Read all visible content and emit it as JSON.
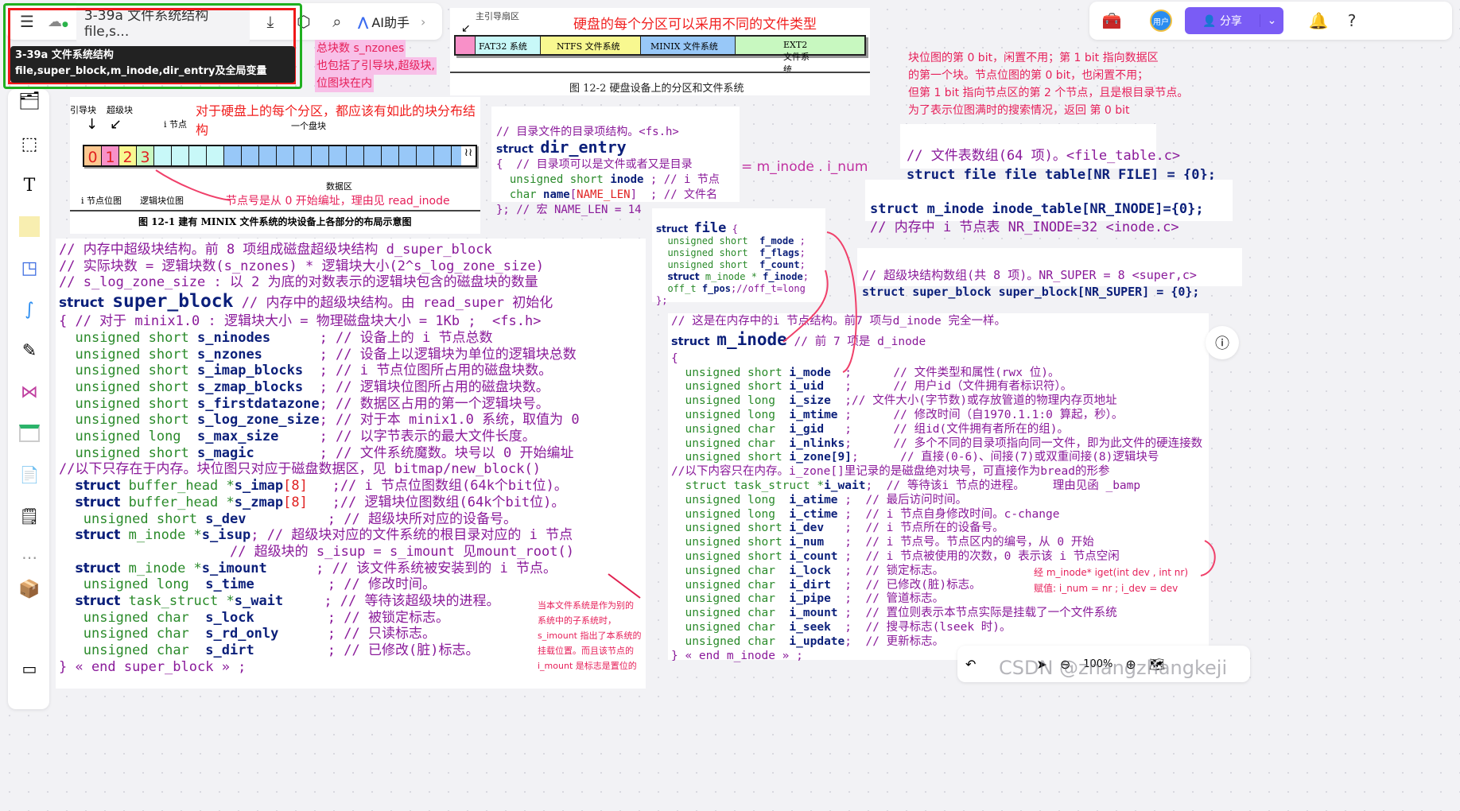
{
  "toolbar": {
    "menu_icon": "hamburger-icon",
    "cloud_icon": "cloud-synced-icon",
    "doc_title": "3-39a 文件系统结构file,s...",
    "tooltip": "3-39a  文件系统结构file,super_block,m_inode,dir_entry及全局变量",
    "ai_label": "AI助手",
    "share_label": "分享",
    "avatar_label": "用户"
  },
  "bottom_bar": {
    "zoom": "100%",
    "watermark": "CSDN @zhangzhangkeji"
  },
  "pink_note": [
    "总块数 s_nzones",
    "也包括了引导块,超级块,",
    "位图块在内"
  ],
  "fig122": {
    "label_mbr": "主引导扇区",
    "red_title": "硬盘的每个分区可以采用不同的文件类型",
    "partitions": [
      "FAT32 系统",
      "NTFS 文件系统",
      "MINIX 文件系统",
      "EXT2 文件系统"
    ],
    "caption": "图 12-2  硬盘设备上的分区和文件系统"
  },
  "fig121": {
    "label_boot": "引导块",
    "label_super": "超级块",
    "label_inode": "i 节点",
    "label_block": "一个盘块",
    "label_imap": "i 节点位图",
    "label_zmap": "逻辑块位图",
    "label_data": "数据区",
    "red_title": "对于硬盘上的每个分区，都应该有如此的块分布结构",
    "red_note": "节点号是从 0 开始编址，理由见 read_inode",
    "cells": [
      "0",
      "1",
      "2",
      "3"
    ],
    "caption": "图 12-1  建有 MINIX 文件系统的块设备上各部分的布局示意图"
  },
  "right_note": [
    "块位图的第 0  bit，闲置不用；第 1 bit 指向数据区",
    "的第一个块。节点位图的第 0 bit，也闲置不用；",
    "但第 1 bit 指向节点区的第 2 个节点，且是根目录节点。",
    "为了表示位图满时的搜索情况，返回 第 0 bit"
  ],
  "dir_entry": {
    "l1": "// 目录文件的目录项结构。<fs.h>",
    "struct": "struct",
    "name": "dir_entry",
    "l3": "{  // 目录项可以是文件或者又是目录",
    "l4a": "unsigned short",
    "l4b": "inode",
    "l4c": " ; // i 节点",
    "l5a": "char",
    "l5b": "name",
    "l5c": "NAME_LEN",
    "l5d": "  ; // 文件名",
    "l6": "}; // 宏 NAME_LEN = 14",
    "annot": "= m_inode . i_num"
  },
  "file_table": {
    "c": "// 文件表数组(64 项)。<file_table.c>",
    "code": "struct file file_table[NR_FILE] = {0};"
  },
  "inode_table": {
    "code": "struct m_inode inode_table[NR_INODE]={0};",
    "c": "// 内存中 i 节点表 NR_INODE=32 <inode.c>"
  },
  "super_array": {
    "c": "// 超级块结构数组(共 8 项)。NR_SUPER = 8 <super,c>",
    "code": "struct super_block super_block[NR_SUPER] = {0};"
  },
  "file_struct": {
    "head": "file",
    "fields": [
      {
        "t": "unsigned short",
        "n": "f_mode",
        "e": " ;"
      },
      {
        "t": "unsigned short",
        "n": "f_flags",
        "e": ";"
      },
      {
        "t": "unsigned short",
        "n": "f_count",
        "e": ";"
      },
      {
        "t": "m_inode *",
        "n": "f_inode",
        "e": ";"
      },
      {
        "t": "off_t",
        "n": "f_pos",
        "e": ";//off_t=long"
      }
    ],
    "end": "};"
  },
  "super_block": {
    "c1": "// 内存中超级块结构。前 8 项组成磁盘超级块结构 d_super_block",
    "c2": "// 实际块数 = 逻辑块数(s_nzones) * 逻辑块大小(2^s_log_zone_size)",
    "c3": "// s_log_zone_size : 以 2 为底的对数表示的逻辑块包含的磁盘块的数量",
    "name": "super_block",
    "c4": " // 内存中的超级块结构。由 read_super 初始化",
    "c5": "{ // 对于 minix1.0 : 逻辑块大小 = 物理磁盘块大小 = 1Kb ;  <fs.h>",
    "fields": [
      [
        "unsigned short",
        "s_ninodes",
        "      ; // 设备上的 i 节点总数"
      ],
      [
        "unsigned short",
        "s_nzones",
        "       ; // 设备上以逻辑块为单位的逻辑块总数"
      ],
      [
        "unsigned short",
        "s_imap_blocks",
        "  ; // i 节点位图所占用的磁盘块数。"
      ],
      [
        "unsigned short",
        "s_zmap_blocks",
        "  ; // 逻辑块位图所占用的磁盘块数。"
      ],
      [
        "unsigned short",
        "s_firstdatazone",
        "; // 数据区占用的第一个逻辑块号。"
      ],
      [
        "unsigned short",
        "s_log_zone_size",
        "; // 对于本 minix1.0 系统，取值为 0"
      ],
      [
        "unsigned long ",
        "s_max_size",
        "     ; // 以字节表示的最大文件长度。"
      ],
      [
        "unsigned short",
        "s_magic",
        "        ; // 文件系统魔数。块号以 0 开始编址"
      ]
    ],
    "mem_note": "//以下只存在于内存。块位图只对应于磁盘数据区，见 bitmap/new_block()",
    "fields2": [
      [
        "struct",
        "buffer_head *",
        "s_imap",
        "[8]",
        "   ;// i 节点位图数组(64k个bit位)。"
      ],
      [
        "struct",
        "buffer_head *",
        "s_zmap",
        "[8]",
        "   ;// 逻辑块位图数组(64k个bit位)。"
      ],
      [
        "",
        "unsigned short ",
        "s_dev",
        "",
        "          ; // 超级块所对应的设备号。"
      ],
      [
        "struct",
        "m_inode *",
        "s_isup",
        "",
        "; // 超级块对应的文件系统的根目录对应的 i 节点"
      ],
      [
        "",
        "",
        "",
        "",
        "                  // 超级块的 s_isup = s_imount 见mount_root()"
      ],
      [
        "struct",
        "m_inode *",
        "s_imount",
        "",
        "      ; // 该文件系统被安装到的 i 节点。"
      ],
      [
        "",
        "unsigned long  ",
        "s_time",
        "",
        "         ; // 修改时间。"
      ],
      [
        "struct",
        "task_struct *",
        "s_wait",
        "",
        "     ; // 等待该超级块的进程。"
      ],
      [
        "",
        "unsigned char  ",
        "s_lock",
        "",
        "         ; // 被锁定标志。"
      ],
      [
        "",
        "unsigned char  ",
        "s_rd_only",
        "",
        "      ; // 只读标志。"
      ],
      [
        "",
        "unsigned char  ",
        "s_dirt",
        "",
        "         ; // 已修改(脏)标志。"
      ]
    ],
    "end": "} « end super_block » ;",
    "note": [
      "当本文件系统是作为别的",
      "系统中的子系统时，",
      "s_imount 指出了本系统的",
      "挂载位置。而且该节点的",
      "i_mount 是标志是置位的"
    ]
  },
  "m_inode": {
    "c1": "// 这是在内存中的i 节点结构。前7 项与d_inode 完全一样。",
    "name": "m_inode",
    "c2": " // 前 7 项是 d_inode",
    "fields": [
      [
        "unsigned short ",
        "i_mode",
        "  ;",
        "      // 文件类型和属性(rwx 位)。"
      ],
      [
        "unsigned short ",
        "i_uid",
        "   ;",
        "      // 用户id（文件拥有者标识符）。"
      ],
      [
        "unsigned long  ",
        "i_size",
        "  ;",
        "// 文件大小(字节数)或存放管道的物理内存页地址"
      ],
      [
        "unsigned long  ",
        "i_mtime",
        " ;",
        "      // 修改时间（自1970.1.1:0 算起，秒）。"
      ],
      [
        "unsigned char  ",
        "i_gid",
        "   ;",
        "      // 组id(文件拥有者所在的组)。"
      ],
      [
        "unsigned char  ",
        "i_nlinks",
        ";",
        "      // 多个不同的目录项指向同一文件，即为此文件的硬连接数"
      ],
      [
        "unsigned short ",
        "i_zone[9]",
        ";",
        "      // 直接(0-6)、间接(7)或双重间接(8)逻辑块号"
      ]
    ],
    "mem_note": "//以下内容只在内存。i_zone[]里记录的是磁盘绝对块号，可直接作为bread的形参",
    "fields2": [
      [
        "struct task_struct *",
        "i_wait",
        ";",
        "  // 等待该i 节点的进程。    理由见函 _bamp"
      ],
      [
        "unsigned long  ",
        "i_atime",
        " ;",
        "  // 最后访问时间。"
      ],
      [
        "unsigned long  ",
        "i_ctime",
        " ;",
        "  // i 节点自身修改时间。c-change"
      ],
      [
        "unsigned short ",
        "i_dev",
        "   ;",
        "  // i 节点所在的设备号。"
      ],
      [
        "unsigned short ",
        "i_num",
        "   ;",
        "  // i 节点号。节点区内的编号，从 0 开始"
      ],
      [
        "unsigned short ",
        "i_count",
        " ;",
        "  // i 节点被使用的次数，0 表示该 i 节点空闲"
      ],
      [
        "unsigned char  ",
        "i_lock",
        "  ;",
        "  // 锁定标志。"
      ],
      [
        "unsigned char  ",
        "i_dirt",
        "  ;",
        "  // 已修改(脏)标志。"
      ],
      [
        "unsigned char  ",
        "i_pipe",
        "  ;",
        "  // 管道标志。"
      ],
      [
        "unsigned char  ",
        "i_mount",
        " ;",
        "  // 置位则表示本节点实际是挂载了一个文件系统"
      ],
      [
        "unsigned char  ",
        "i_seek",
        "  ;",
        "  // 搜寻标志(lseek 时)。"
      ],
      [
        "unsigned char  ",
        "i_update",
        ";",
        "  // 更新标志。"
      ]
    ],
    "end": "} « end m_inode » ;",
    "iget_note": [
      "经 m_inode* iget(int dev , int nr)",
      "赋值:   i_num = nr ; i_dev = dev"
    ]
  }
}
